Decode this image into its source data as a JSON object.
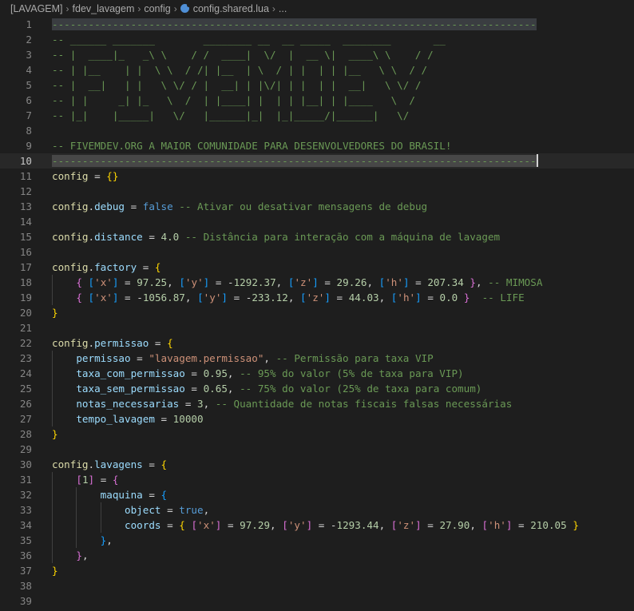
{
  "breadcrumb": {
    "items": [
      "[LAVAGEM]",
      "fdev_lavagem",
      "config",
      "config.shared.lua",
      "..."
    ],
    "separator": "›"
  },
  "editor": {
    "active_line": 10,
    "lines": [
      {
        "n": "1",
        "parts": [
          [
            "hl",
            "--------------------------------------------------------------------------------"
          ]
        ]
      },
      {
        "n": "2",
        "parts": [
          [
            "cm",
            "-- ______ _______        ________ __  __ _____  ________       __"
          ]
        ]
      },
      {
        "n": "3",
        "parts": [
          [
            "cm",
            "-- |  ____|_   _\\ \\    / /  ____|  \\/  |  __ \\|  ____\\ \\    / /"
          ]
        ]
      },
      {
        "n": "4",
        "parts": [
          [
            "cm",
            "-- | |__    | |  \\ \\  / /| |__  | \\  / | |  | | |__   \\ \\  / /"
          ]
        ]
      },
      {
        "n": "5",
        "parts": [
          [
            "cm",
            "-- |  __|   | |   \\ \\/ / |  __| | |\\/| | |  | |  __|   \\ \\/ /"
          ]
        ]
      },
      {
        "n": "6",
        "parts": [
          [
            "cm",
            "-- | |     _| |_   \\  /  | |____| |  | | |__| | |____   \\  /"
          ]
        ]
      },
      {
        "n": "7",
        "parts": [
          [
            "cm",
            "-- |_|    |_____|   \\/   |______|_|  |_|_____/|______|   \\/"
          ]
        ]
      },
      {
        "n": "8",
        "parts": []
      },
      {
        "n": "9",
        "parts": [
          [
            "cm",
            "-- FIVEMDEV.ORG A MAIOR COMUNIDADE PARA DESENVOLVEDORES DO BRASIL!"
          ]
        ]
      },
      {
        "n": "10",
        "parts": [
          [
            "hlcur",
            "--------------------------------------------------------------------------------"
          ]
        ]
      },
      {
        "n": "11",
        "parts": [
          [
            "fn",
            "config"
          ],
          [
            "op",
            " = "
          ],
          [
            "b1",
            "{}"
          ]
        ]
      },
      {
        "n": "12",
        "parts": []
      },
      {
        "n": "13",
        "parts": [
          [
            "fn",
            "config"
          ],
          [
            "op",
            "."
          ],
          [
            "var",
            "debug"
          ],
          [
            "op",
            " = "
          ],
          [
            "kw",
            "false"
          ],
          [
            "cm",
            " -- Ativar ou desativar mensagens de debug"
          ]
        ]
      },
      {
        "n": "14",
        "parts": []
      },
      {
        "n": "15",
        "parts": [
          [
            "fn",
            "config"
          ],
          [
            "op",
            "."
          ],
          [
            "var",
            "distance"
          ],
          [
            "op",
            " = "
          ],
          [
            "num",
            "4.0"
          ],
          [
            "cm",
            " -- Distância para interação com a máquina de lavagem"
          ]
        ]
      },
      {
        "n": "16",
        "parts": []
      },
      {
        "n": "17",
        "parts": [
          [
            "fn",
            "config"
          ],
          [
            "op",
            "."
          ],
          [
            "var",
            "factory"
          ],
          [
            "op",
            " = "
          ],
          [
            "b1",
            "{"
          ]
        ]
      },
      {
        "n": "18",
        "indent": 1,
        "parts": [
          [
            "b2",
            "{"
          ],
          [
            "op",
            " "
          ],
          [
            "b3",
            "["
          ],
          [
            "str",
            "'x'"
          ],
          [
            "b3",
            "]"
          ],
          [
            "op",
            " = "
          ],
          [
            "num",
            "97.25"
          ],
          [
            "op",
            ", "
          ],
          [
            "b3",
            "["
          ],
          [
            "str",
            "'y'"
          ],
          [
            "b3",
            "]"
          ],
          [
            "op",
            " = "
          ],
          [
            "op",
            "-"
          ],
          [
            "num",
            "1292.37"
          ],
          [
            "op",
            ", "
          ],
          [
            "b3",
            "["
          ],
          [
            "str",
            "'z'"
          ],
          [
            "b3",
            "]"
          ],
          [
            "op",
            " = "
          ],
          [
            "num",
            "29.26"
          ],
          [
            "op",
            ", "
          ],
          [
            "b3",
            "["
          ],
          [
            "str",
            "'h'"
          ],
          [
            "b3",
            "]"
          ],
          [
            "op",
            " = "
          ],
          [
            "num",
            "207.34"
          ],
          [
            "op",
            " "
          ],
          [
            "b2",
            "}"
          ],
          [
            "op",
            ", "
          ],
          [
            "cm",
            "-- MIMOSA"
          ]
        ]
      },
      {
        "n": "19",
        "indent": 1,
        "parts": [
          [
            "b2",
            "{"
          ],
          [
            "op",
            " "
          ],
          [
            "b3",
            "["
          ],
          [
            "str",
            "'x'"
          ],
          [
            "b3",
            "]"
          ],
          [
            "op",
            " = "
          ],
          [
            "op",
            "-"
          ],
          [
            "num",
            "1056.87"
          ],
          [
            "op",
            ", "
          ],
          [
            "b3",
            "["
          ],
          [
            "str",
            "'y'"
          ],
          [
            "b3",
            "]"
          ],
          [
            "op",
            " = "
          ],
          [
            "op",
            "-"
          ],
          [
            "num",
            "233.12"
          ],
          [
            "op",
            ", "
          ],
          [
            "b3",
            "["
          ],
          [
            "str",
            "'z'"
          ],
          [
            "b3",
            "]"
          ],
          [
            "op",
            " = "
          ],
          [
            "num",
            "44.03"
          ],
          [
            "op",
            ", "
          ],
          [
            "b3",
            "["
          ],
          [
            "str",
            "'h'"
          ],
          [
            "b3",
            "]"
          ],
          [
            "op",
            " = "
          ],
          [
            "num",
            "0.0"
          ],
          [
            "op",
            " "
          ],
          [
            "b2",
            "}"
          ],
          [
            "op",
            "  "
          ],
          [
            "cm",
            "-- LIFE"
          ]
        ]
      },
      {
        "n": "20",
        "parts": [
          [
            "b1",
            "}"
          ]
        ]
      },
      {
        "n": "21",
        "parts": []
      },
      {
        "n": "22",
        "parts": [
          [
            "fn",
            "config"
          ],
          [
            "op",
            "."
          ],
          [
            "var",
            "permissao"
          ],
          [
            "op",
            " = "
          ],
          [
            "b1",
            "{"
          ]
        ]
      },
      {
        "n": "23",
        "indent": 1,
        "parts": [
          [
            "var",
            "permissao"
          ],
          [
            "op",
            " = "
          ],
          [
            "str",
            "\"lavagem.permissao\""
          ],
          [
            "op",
            ", "
          ],
          [
            "cm",
            "-- Permissão para taxa VIP"
          ]
        ]
      },
      {
        "n": "24",
        "indent": 1,
        "parts": [
          [
            "var",
            "taxa_com_permissao"
          ],
          [
            "op",
            " = "
          ],
          [
            "num",
            "0.95"
          ],
          [
            "op",
            ", "
          ],
          [
            "cm",
            "-- 95% do valor (5% de taxa para VIP)"
          ]
        ]
      },
      {
        "n": "25",
        "indent": 1,
        "parts": [
          [
            "var",
            "taxa_sem_permissao"
          ],
          [
            "op",
            " = "
          ],
          [
            "num",
            "0.65"
          ],
          [
            "op",
            ", "
          ],
          [
            "cm",
            "-- 75% do valor (25% de taxa para comum)"
          ]
        ]
      },
      {
        "n": "26",
        "indent": 1,
        "parts": [
          [
            "var",
            "notas_necessarias"
          ],
          [
            "op",
            " = "
          ],
          [
            "num",
            "3"
          ],
          [
            "op",
            ", "
          ],
          [
            "cm",
            "-- Quantidade de notas fiscais falsas necessárias"
          ]
        ]
      },
      {
        "n": "27",
        "indent": 1,
        "parts": [
          [
            "var",
            "tempo_lavagem"
          ],
          [
            "op",
            " = "
          ],
          [
            "num",
            "10000"
          ]
        ]
      },
      {
        "n": "28",
        "parts": [
          [
            "b1",
            "}"
          ]
        ]
      },
      {
        "n": "29",
        "parts": []
      },
      {
        "n": "30",
        "parts": [
          [
            "fn",
            "config"
          ],
          [
            "op",
            "."
          ],
          [
            "var",
            "lavagens"
          ],
          [
            "op",
            " = "
          ],
          [
            "b1",
            "{"
          ]
        ]
      },
      {
        "n": "31",
        "indent": 1,
        "parts": [
          [
            "b2",
            "["
          ],
          [
            "num",
            "1"
          ],
          [
            "b2",
            "]"
          ],
          [
            "op",
            " = "
          ],
          [
            "b2",
            "{"
          ]
        ]
      },
      {
        "n": "32",
        "indent": 2,
        "parts": [
          [
            "var",
            "maquina"
          ],
          [
            "op",
            " = "
          ],
          [
            "b3",
            "{"
          ]
        ]
      },
      {
        "n": "33",
        "indent": 3,
        "parts": [
          [
            "var",
            "object"
          ],
          [
            "op",
            " = "
          ],
          [
            "kw",
            "true"
          ],
          [
            "op",
            ","
          ]
        ]
      },
      {
        "n": "34",
        "indent": 3,
        "parts": [
          [
            "var",
            "coords"
          ],
          [
            "op",
            " = "
          ],
          [
            "b1",
            "{"
          ],
          [
            "op",
            " "
          ],
          [
            "b2",
            "["
          ],
          [
            "str",
            "'x'"
          ],
          [
            "b2",
            "]"
          ],
          [
            "op",
            " = "
          ],
          [
            "num",
            "97.29"
          ],
          [
            "op",
            ", "
          ],
          [
            "b2",
            "["
          ],
          [
            "str",
            "'y'"
          ],
          [
            "b2",
            "]"
          ],
          [
            "op",
            " = "
          ],
          [
            "op",
            "-"
          ],
          [
            "num",
            "1293.44"
          ],
          [
            "op",
            ", "
          ],
          [
            "b2",
            "["
          ],
          [
            "str",
            "'z'"
          ],
          [
            "b2",
            "]"
          ],
          [
            "op",
            " = "
          ],
          [
            "num",
            "27.90"
          ],
          [
            "op",
            ", "
          ],
          [
            "b2",
            "["
          ],
          [
            "str",
            "'h'"
          ],
          [
            "b2",
            "]"
          ],
          [
            "op",
            " = "
          ],
          [
            "num",
            "210.05"
          ],
          [
            "op",
            " "
          ],
          [
            "b1",
            "}"
          ]
        ]
      },
      {
        "n": "35",
        "indent": 2,
        "parts": [
          [
            "b3",
            "}"
          ],
          [
            "op",
            ","
          ]
        ]
      },
      {
        "n": "36",
        "indent": 1,
        "parts": [
          [
            "b2",
            "}"
          ],
          [
            "op",
            ","
          ]
        ]
      },
      {
        "n": "37",
        "parts": [
          [
            "b1",
            "}"
          ]
        ]
      },
      {
        "n": "38",
        "parts": []
      },
      {
        "n": "39",
        "parts": []
      }
    ]
  }
}
